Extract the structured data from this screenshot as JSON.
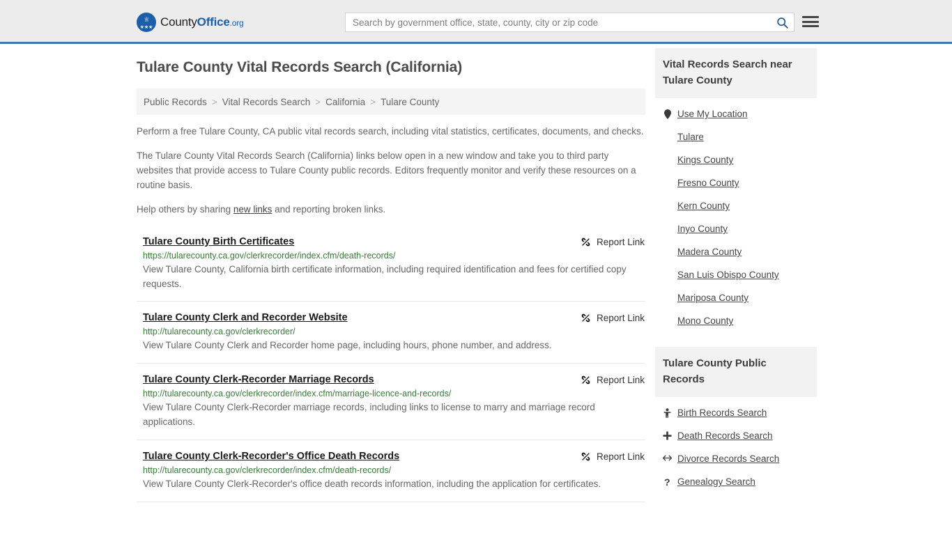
{
  "header": {
    "logo": {
      "name_part1": "County",
      "name_part2": "Office",
      "tld": ".org",
      "icon": "eagle-shield-icon"
    },
    "search": {
      "placeholder": "Search by government office, state, county, city or zip code",
      "value": "",
      "icon": "search-icon"
    },
    "menu_icon": "hamburger-menu-icon",
    "accent_color": "#3b78ae",
    "background_color": "#ececec"
  },
  "main": {
    "title": "Tulare County Vital Records Search (California)",
    "breadcrumb": [
      {
        "label": "Public Records"
      },
      {
        "label": "Vital Records Search"
      },
      {
        "label": "California"
      },
      {
        "label": "Tulare County"
      }
    ],
    "breadcrumb_separator": ">",
    "intro": {
      "p1": "Perform a free Tulare County, CA public vital records search, including vital statistics, certificates, documents, and checks.",
      "p2": "The Tulare County Vital Records Search (California) links below open in a new window and take you to third party websites that provide access to Tulare County public records. Editors frequently monitor and verify these resources on a routine basis.",
      "p3_before": "Help others by sharing ",
      "p3_link": "new links",
      "p3_after": " and reporting broken links."
    },
    "report_link_label": "Report Link",
    "report_link_icon": "broken-link-icon",
    "results": [
      {
        "title": "Tulare County Birth Certificates",
        "url": "https://tularecounty.ca.gov/clerkrecorder/index.cfm/death-records/",
        "description": "View Tulare County, California birth certificate information, including required identification and fees for certified copy requests."
      },
      {
        "title": " Tulare County Clerk and Recorder Website",
        "url": "http://tularecounty.ca.gov/clerkrecorder/",
        "description": "View Tulare County Clerk and Recorder home page, including hours, phone number, and address."
      },
      {
        "title": "Tulare County Clerk-Recorder Marriage Records",
        "url": "http://tularecounty.ca.gov/clerkrecorder/index.cfm/marriage-licence-and-records/",
        "description": "View Tulare County Clerk-Recorder marriage records, including links to license to marry and marriage record applications."
      },
      {
        "title": "Tulare County Clerk-Recorder's Office Death Records",
        "url": "http://tularecounty.ca.gov/clerkrecorder/index.cfm/death-records/",
        "description": "View Tulare County Clerk-Recorder's office death records information, including the application for certificates."
      }
    ]
  },
  "sidebar": {
    "nearby": {
      "title": "Vital Records Search near Tulare County",
      "items": [
        {
          "label": "Use My Location",
          "icon": "map-pin-icon"
        },
        {
          "label": "Tulare",
          "icon": ""
        },
        {
          "label": "Kings County",
          "icon": ""
        },
        {
          "label": "Fresno County",
          "icon": ""
        },
        {
          "label": "Kern County",
          "icon": ""
        },
        {
          "label": "Inyo County",
          "icon": ""
        },
        {
          "label": "Madera County",
          "icon": ""
        },
        {
          "label": "San Luis Obispo County",
          "icon": ""
        },
        {
          "label": "Mariposa County",
          "icon": ""
        },
        {
          "label": "Mono County",
          "icon": ""
        }
      ]
    },
    "public_records": {
      "title": "Tulare County Public Records",
      "items": [
        {
          "label": "Birth Records Search",
          "icon": "baby-icon"
        },
        {
          "label": "Death Records Search",
          "icon": "cross-icon"
        },
        {
          "label": "Divorce Records Search",
          "icon": "left-right-arrow-icon"
        },
        {
          "label": "Genealogy Search",
          "icon": "question-mark-icon"
        }
      ]
    }
  }
}
